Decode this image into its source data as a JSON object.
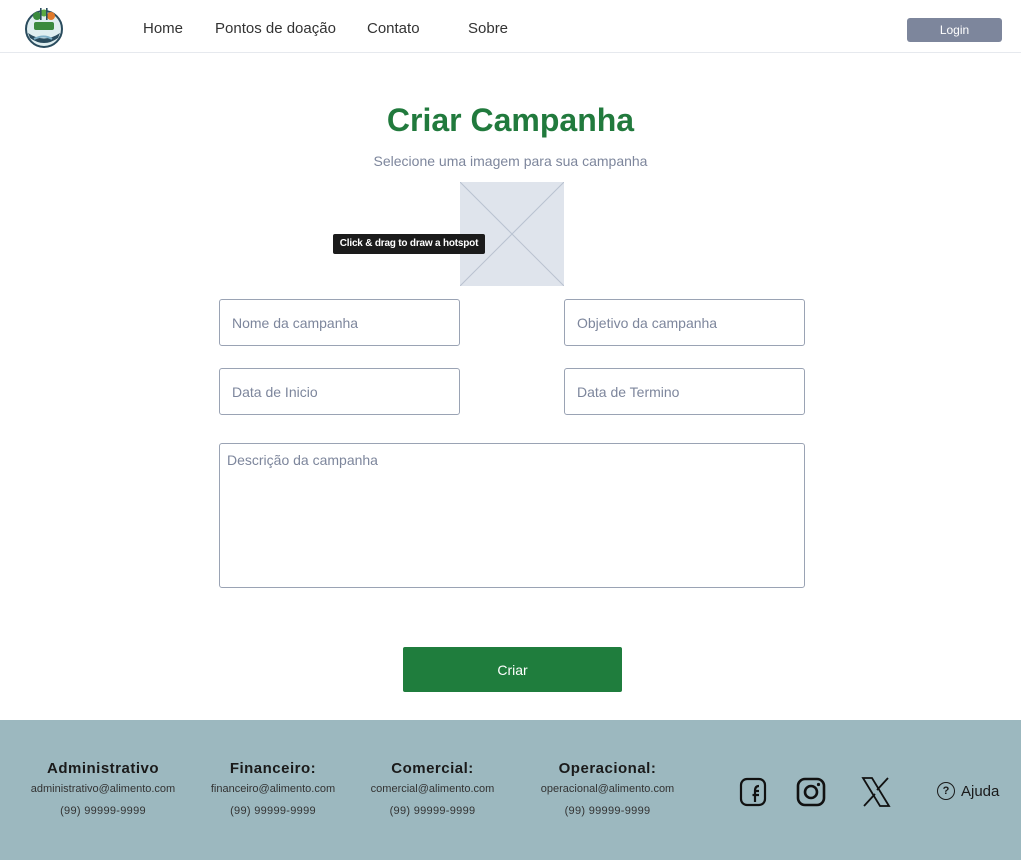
{
  "nav": {
    "items": [
      "Home",
      "Pontos de doação",
      "Contato",
      "Sobre"
    ],
    "login_label": "Login"
  },
  "main": {
    "title": "Criar Campanha",
    "subtitle": "Selecione uma imagem para sua campanha",
    "tooltip": "Click & drag to draw a hotspot",
    "fields": {
      "nome_placeholder": "Nome da campanha",
      "objetivo_placeholder": "Objetivo da campanha",
      "inicio_placeholder": "Data de Inicio",
      "termino_placeholder": "Data de Termino",
      "descricao_placeholder": "Descrição da campanha"
    },
    "submit_label": "Criar"
  },
  "footer": {
    "contacts": [
      {
        "head": "Administrativo",
        "email": "administrativo@alimento.com",
        "phone": "(99) 99999-9999"
      },
      {
        "head": "Financeiro:",
        "email": "financeiro@alimento.com",
        "phone": "(99) 99999-9999"
      },
      {
        "head": "Comercial:",
        "email": "comercial@alimento.com",
        "phone": "(99) 99999-9999"
      },
      {
        "head": "Operacional:",
        "email": "operacional@alimento.com",
        "phone": "(99) 99999-9999"
      }
    ],
    "social_icons": [
      "facebook-icon",
      "instagram-icon",
      "x-icon"
    ],
    "help_label": "Ajuda"
  },
  "colors": {
    "brand_green": "#217a3d",
    "button_green": "#1f7d3d",
    "login_gray": "#7d869c",
    "footer_bg": "#9cb8bf"
  }
}
